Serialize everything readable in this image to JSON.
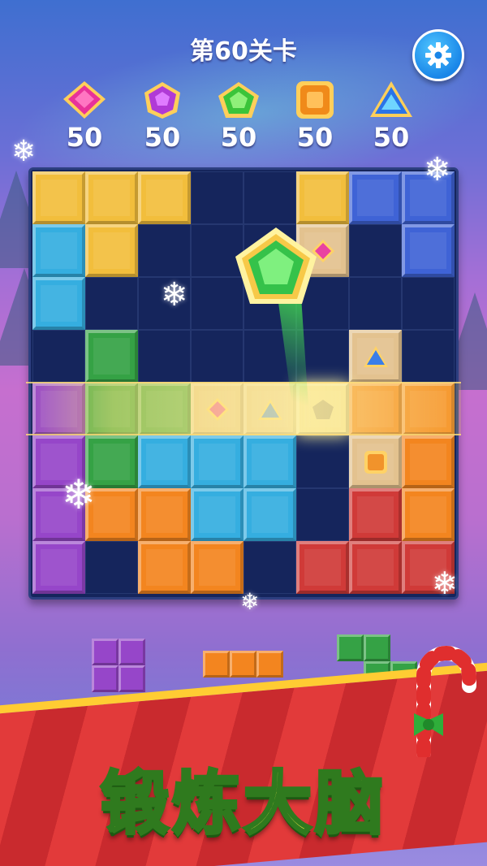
{
  "header": {
    "level_title": "第60关卡"
  },
  "goals": [
    {
      "gem": "pink-diamond-gem-icon",
      "count": "50",
      "color": "#e8329a"
    },
    {
      "gem": "purple-gem-icon",
      "count": "50",
      "color": "#b03ad6"
    },
    {
      "gem": "green-pentagon-gem-icon",
      "count": "50",
      "color": "#3bc43a"
    },
    {
      "gem": "orange-square-gem-icon",
      "count": "50",
      "color": "#f08a1a"
    },
    {
      "gem": "blue-triangle-gem-icon",
      "count": "50",
      "color": "#2a74e8"
    }
  ],
  "board": {
    "grid": "8x8",
    "rows": [
      [
        "yellow",
        "yellow",
        "yellow",
        "empty",
        "empty",
        "yellow",
        "blue",
        "blue"
      ],
      [
        "cyan",
        "yellow",
        "empty",
        "empty",
        "empty",
        "tan-pink-gem",
        "empty",
        "blue"
      ],
      [
        "cyan",
        "empty",
        "empty",
        "empty",
        "empty",
        "empty",
        "empty",
        "empty"
      ],
      [
        "empty",
        "green",
        "empty",
        "empty",
        "empty",
        "empty",
        "tan-blue-gem",
        "empty"
      ],
      [
        "purple",
        "green",
        "green",
        "tan-pink-gem",
        "tan-blue-gem",
        "tan-highlight",
        "orange",
        "orange"
      ],
      [
        "purple",
        "green",
        "cyan",
        "cyan",
        "cyan",
        "empty",
        "tan-orange-gem",
        "orange"
      ],
      [
        "purple",
        "orange",
        "orange",
        "cyan",
        "cyan",
        "empty",
        "red",
        "orange"
      ],
      [
        "purple",
        "empty",
        "orange",
        "orange",
        "empty",
        "red",
        "red",
        "red"
      ]
    ]
  },
  "pieces": [
    {
      "name": "square-piece",
      "color": "#9646c9"
    },
    {
      "name": "line-piece",
      "color": "#f3851f"
    },
    {
      "name": "z-piece",
      "color": "#35a245"
    }
  ],
  "colors": {
    "yellow": "#f2be3c",
    "blue": "#3f63d6",
    "cyan": "#35aee0",
    "green": "#35a245",
    "purple": "#9646c9",
    "orange": "#f3851f",
    "red": "#d03a38",
    "tan": "#e3c28f"
  },
  "banner": {
    "slogan": "锻炼大脑"
  }
}
